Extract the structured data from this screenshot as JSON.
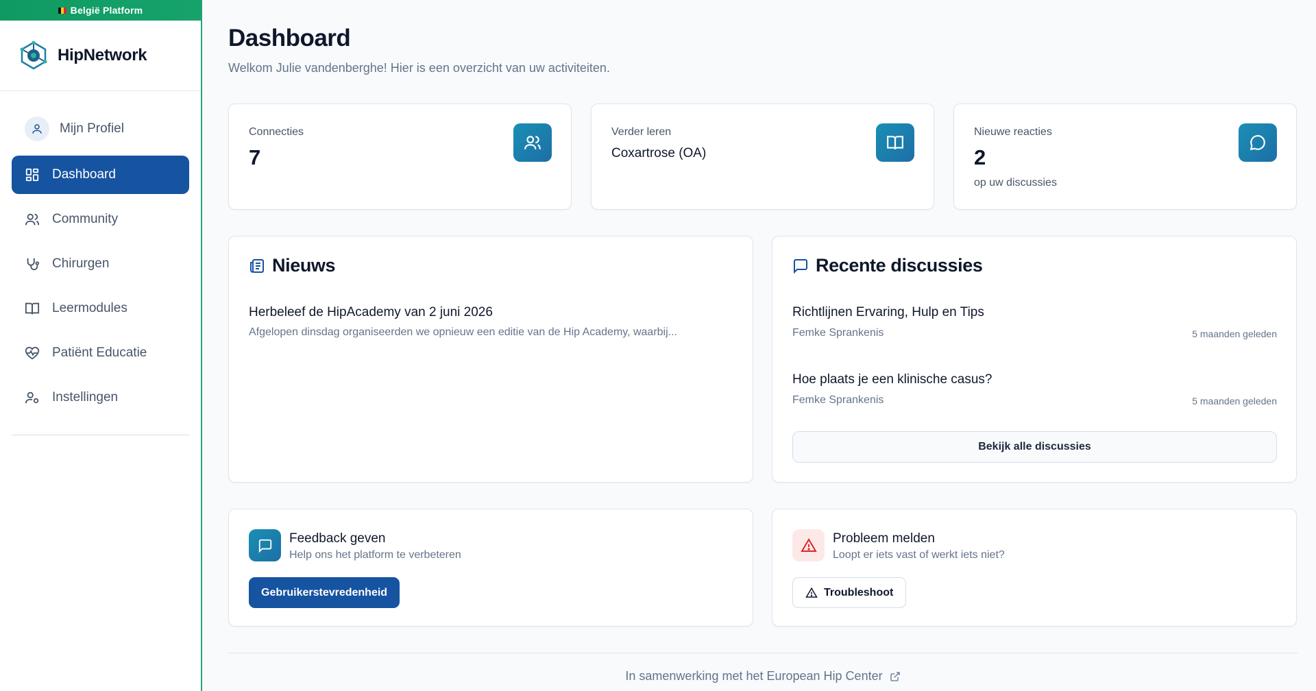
{
  "platform_banner": "België Platform",
  "brand": {
    "name": "HipNetwork"
  },
  "sidebar": {
    "profile_label": "Mijn Profiel",
    "items": [
      {
        "label": "Dashboard",
        "icon": "dashboard-icon",
        "active": true
      },
      {
        "label": "Community",
        "icon": "users-icon",
        "active": false
      },
      {
        "label": "Chirurgen",
        "icon": "stethoscope-icon",
        "active": false
      },
      {
        "label": "Leermodules",
        "icon": "book-open-icon",
        "active": false
      },
      {
        "label": "Patiënt Educatie",
        "icon": "heart-pulse-icon",
        "active": false
      },
      {
        "label": "Instellingen",
        "icon": "user-cog-icon",
        "active": false
      }
    ]
  },
  "header": {
    "title": "Dashboard",
    "subtitle": "Welkom Julie vandenberghe! Hier is een overzicht van uw activiteiten."
  },
  "stats": {
    "connections": {
      "label": "Connecties",
      "value": "7",
      "icon": "users-icon"
    },
    "learning": {
      "label": "Verder leren",
      "value": "Coxartrose (OA)",
      "icon": "book-open-icon"
    },
    "reactions": {
      "label": "Nieuwe reacties",
      "value": "2",
      "sub": "op uw discussies",
      "icon": "message-circle-icon"
    }
  },
  "news": {
    "title": "Nieuws",
    "items": [
      {
        "title": "Herbeleef de HipAcademy van 2 juni 2026",
        "excerpt": "Afgelopen dinsdag organiseerden we opnieuw een editie van de Hip Academy, waarbij..."
      }
    ]
  },
  "discussions": {
    "title": "Recente discussies",
    "items": [
      {
        "title": "Richtlijnen Ervaring, Hulp en Tips",
        "author": "Femke Sprankenis",
        "time": "5 maanden geleden"
      },
      {
        "title": "Hoe plaats je een klinische casus?",
        "author": "Femke Sprankenis",
        "time": "5 maanden geleden"
      }
    ],
    "view_all_label": "Bekijk alle discussies"
  },
  "feedback": {
    "title": "Feedback geven",
    "subtitle": "Help ons het platform te verbeteren",
    "button_label": "Gebruikerstevredenheid"
  },
  "problem": {
    "title": "Probleem melden",
    "subtitle": "Loopt er iets vast of werkt iets niet?",
    "button_label": "Troubleshoot"
  },
  "footer": {
    "text": "In samenwerking met het European Hip Center"
  },
  "colors": {
    "primary": "#1653a0",
    "accent": "#1a8fb4",
    "banner": "#16a36a",
    "danger": "#dc2626"
  }
}
